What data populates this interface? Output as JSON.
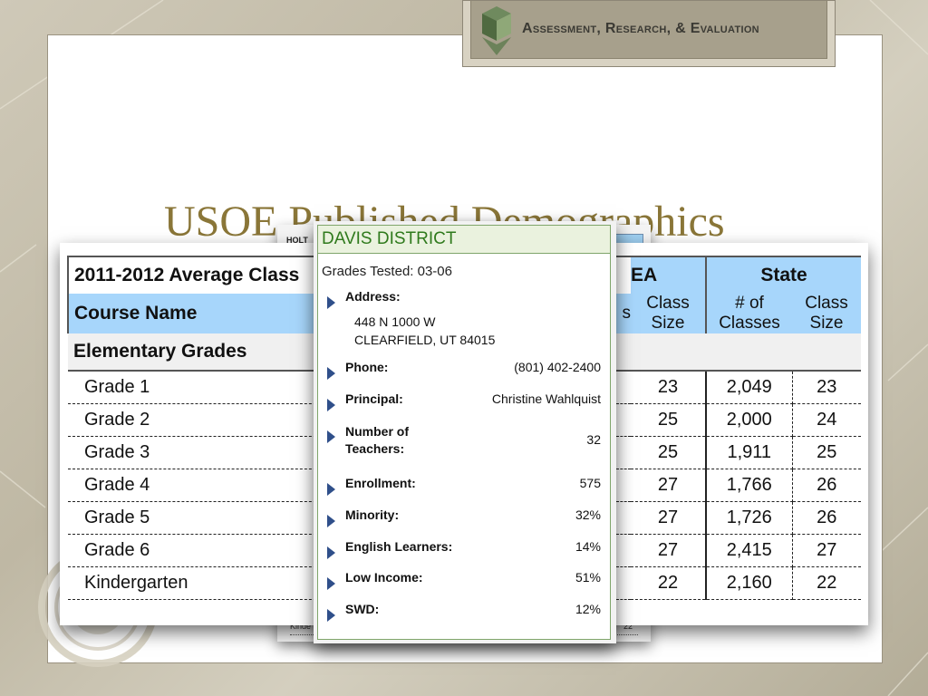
{
  "header": {
    "banner_title": "Assessment, Research, & Evaluation"
  },
  "slide": {
    "title": "USOE Published Demographics"
  },
  "background_table": {
    "holt_label": "HOLT",
    "kinde_label": "Kinde",
    "last_num": "22"
  },
  "avg_table": {
    "title": "2011-2012 Average Class",
    "partial_col_label": "EA",
    "state_label": "State",
    "course_name_label": "Course Name",
    "partial_hidden_label": "s",
    "class_size_label": "Class Size",
    "num_classes_label": "# of Classes",
    "section_label": "Elementary Grades",
    "rows": [
      {
        "course": "Grade 1",
        "rea_size": "23",
        "state_classes": "2,049",
        "state_size": "23"
      },
      {
        "course": "Grade 2",
        "rea_size": "25",
        "state_classes": "2,000",
        "state_size": "24"
      },
      {
        "course": "Grade 3",
        "rea_size": "25",
        "state_classes": "1,911",
        "state_size": "25"
      },
      {
        "course": "Grade 4",
        "rea_size": "27",
        "state_classes": "1,766",
        "state_size": "26"
      },
      {
        "course": "Grade 5",
        "rea_size": "27",
        "state_classes": "1,726",
        "state_size": "26"
      },
      {
        "course": "Grade 6",
        "rea_size": "27",
        "state_classes": "2,415",
        "state_size": "27"
      },
      {
        "course": "Kindergarten",
        "rea_size": "22",
        "state_classes": "2,160",
        "state_size": "22"
      }
    ]
  },
  "district": {
    "title": "DAVIS DISTRICT",
    "grades_tested": "Grades Tested: 03-06",
    "address_label": "Address:",
    "address_line1": "448 N 1000 W",
    "address_line2": "CLEARFIELD, UT 84015",
    "phone_label": "Phone:",
    "phone_value": "(801) 402-2400",
    "principal_label": "Principal:",
    "principal_value": "Christine Wahlquist",
    "teachers_label_1": "Number of",
    "teachers_label_2": "Teachers:",
    "teachers_value": "32",
    "enrollment_label": "Enrollment:",
    "enrollment_value": "575",
    "minority_label": "Minority:",
    "minority_value": "32%",
    "ell_label": "English Learners:",
    "ell_value": "14%",
    "low_income_label": "Low Income:",
    "low_income_value": "51%",
    "swd_label": "SWD:",
    "swd_value": "12%"
  },
  "colors": {
    "title_gold": "#8a7638",
    "table_header_blue": "#a7d6fb",
    "district_green": "#2f7a1c"
  }
}
